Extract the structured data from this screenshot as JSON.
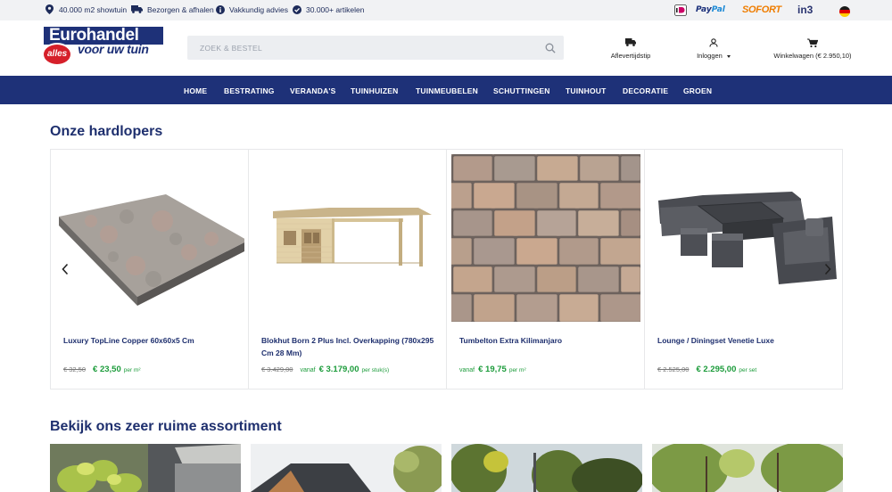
{
  "topbar": {
    "usps": [
      {
        "icon": "location-pin-icon",
        "text": "40.000 m2 showtuin"
      },
      {
        "icon": "truck-icon",
        "text": "Bezorgen & afhalen"
      },
      {
        "icon": "info-icon",
        "text": "Vakkundig advies"
      },
      {
        "icon": "check-icon",
        "text": "30.000+ artikelen"
      }
    ],
    "payments": [
      "iDEAL",
      "PayPal",
      "SOFORT",
      "in3"
    ],
    "language_flag": "german-flag-icon"
  },
  "header": {
    "logo_top": "Eurohandel",
    "logo_badge": "alles",
    "logo_bottom": "voor uw tuin",
    "search_placeholder": "ZOEK & BESTEL",
    "delivery_label": "Aflevertijdstip",
    "login_label": "Inloggen",
    "cart_label": "Winkelwagen (€ 2.950,10)"
  },
  "nav": {
    "items": [
      "HOME",
      "BESTRATING",
      "VERANDA'S",
      "TUINHUIZEN",
      "TUINMEUBELEN",
      "SCHUTTINGEN",
      "TUINHOUT",
      "DECORATIE",
      "GROEN"
    ]
  },
  "bestsellers": {
    "title": "Onze hardlopers",
    "products": [
      {
        "name": "Luxury TopLine Copper 60x60x5 Cm",
        "old_price": "€ 32,50",
        "prefix": "",
        "price": "€ 23,50",
        "unit": "per m²"
      },
      {
        "name": "Blokhut Born 2 Plus Incl. Overkapping (780x295 Cm 28 Mm)",
        "old_price": "€ 3.429,00",
        "prefix": "vanaf",
        "price": "€ 3.179,00",
        "unit": "per stuk(s)"
      },
      {
        "name": "Tumbelton Extra Kilimanjaro",
        "old_price": "",
        "prefix": "vanaf",
        "price": "€ 19,75",
        "unit": "per m²"
      },
      {
        "name": "Lounge / Diningset Venetie Luxe",
        "old_price": "€ 2.525,00",
        "prefix": "",
        "price": "€ 2.295,00",
        "unit": "per set"
      }
    ]
  },
  "assortment": {
    "title": "Bekijk ons zeer ruime assortiment"
  },
  "colors": {
    "nav_bg": "#1e3178",
    "accent_green": "#1b9b3a",
    "title_blue": "#1e2f6e"
  }
}
